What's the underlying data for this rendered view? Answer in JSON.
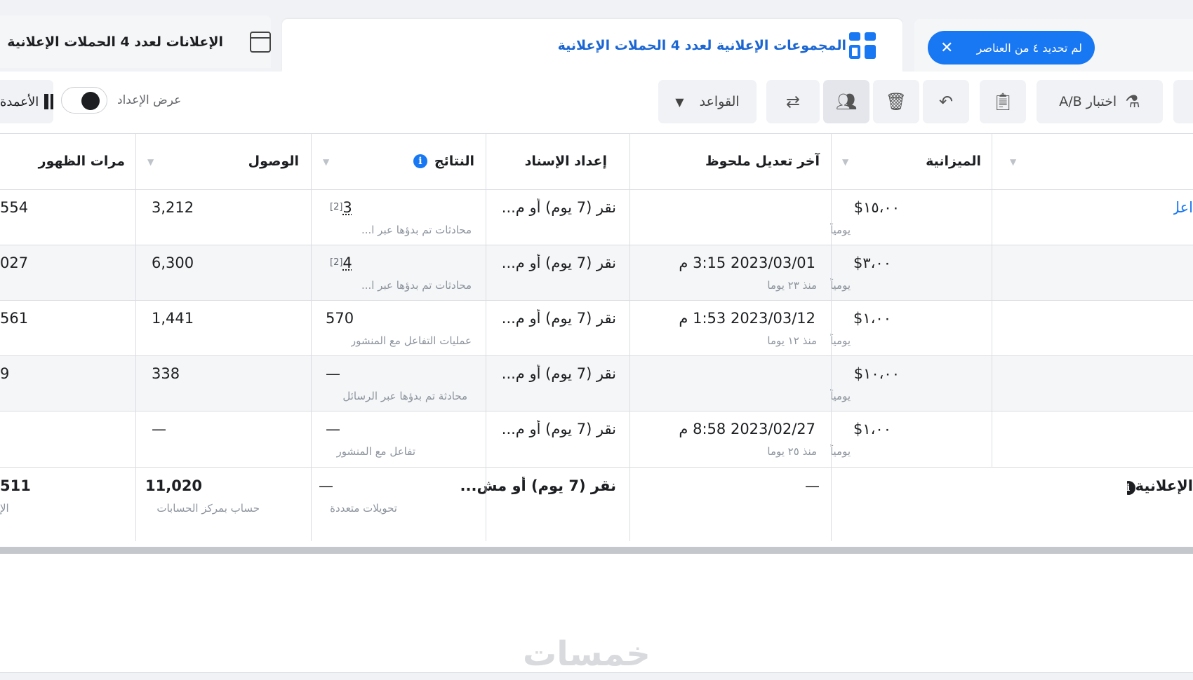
{
  "tabs": {
    "ads_tab": "الإعلانات لعدد 4 الحملات الإعلانية",
    "adsets_tab": "المجموعات الإعلانية لعدد 4 الحملات الإعلانية",
    "selection_chip": "لم تحديد ٤ من العناصر"
  },
  "toolbar": {
    "ab_test": "اختبار A/B",
    "rules": "القواعد",
    "view_setup": "عرض الإعداد",
    "columns": "الأعمدة"
  },
  "table": {
    "headers": {
      "budget": "الميزانية",
      "last_edit": "آخر تعديل ملحوظ",
      "attribution": "إعداد الإسناد",
      "results": "النتائج",
      "reach": "الوصول",
      "impressions": "مرات الظهور"
    },
    "first_row_link": "اعل",
    "rows": [
      {
        "budget": "١٥،٠٠$",
        "budget_sub": "يومياً",
        "last_edit": "",
        "last_edit_sub": "",
        "attribution": "نقر (7 يوم) أو م...",
        "results": "3",
        "results_ref": "[2]",
        "results_sub": "محادثات تم بدؤها عبر ا...",
        "reach": "3,212",
        "impressions": "554"
      },
      {
        "budget": "٣،٠٠$",
        "budget_sub": "يومياً",
        "last_edit": "2023/03/01 3:15 م",
        "last_edit_sub": "منذ ٢٣ يوما",
        "attribution": "نقر (7 يوم) أو م...",
        "results": "4",
        "results_ref": "[2]",
        "results_sub": "محادثات تم بدؤها عبر ا...",
        "reach": "6,300",
        "impressions": "027"
      },
      {
        "budget": "١،٠٠$",
        "budget_sub": "يومياً",
        "last_edit": "2023/03/12 1:53 م",
        "last_edit_sub": "منذ ١٢ يوما",
        "attribution": "نقر (7 يوم) أو م...",
        "results": "570",
        "results_ref": "",
        "results_sub": "عمليات التفاعل مع المنشور",
        "reach": "1,441",
        "impressions": "561"
      },
      {
        "budget": "١٠،٠٠$",
        "budget_sub": "يومياً",
        "last_edit": "",
        "last_edit_sub": "",
        "attribution": "نقر (7 يوم) أو م...",
        "results": "—",
        "results_ref": "",
        "results_sub": "محادثة تم بدؤها عبر الرسائل",
        "reach": "338",
        "impressions": "9"
      },
      {
        "budget": "١،٠٠$",
        "budget_sub": "يومياً",
        "last_edit": "2023/02/27 8:58 م",
        "last_edit_sub": "منذ ٢٥ يوما",
        "attribution": "نقر (7 يوم) أو م...",
        "results": "—",
        "results_ref": "",
        "results_sub": "تفاعل مع المنشور",
        "reach": "—",
        "impressions": ""
      }
    ],
    "totals": {
      "label": "الإعلانية",
      "last_edit": "—",
      "attribution": "نقر (7 يوم) أو مش...",
      "results": "—",
      "results_sub": "تحويلات متعددة",
      "reach": "11,020",
      "reach_sub": "حساب بمركز الحسابات",
      "impressions": "511",
      "impressions_sub": "الإ"
    }
  },
  "watermark": "خمسات"
}
